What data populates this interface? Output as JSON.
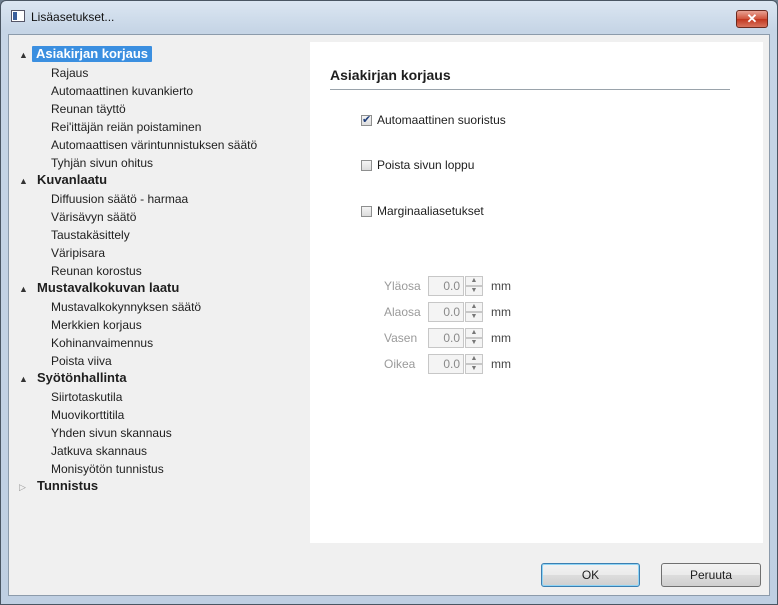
{
  "window": {
    "title": "Lisäasetukset...",
    "close_label": "✕"
  },
  "tree": {
    "categories": [
      {
        "label": "Asiakirjan korjaus",
        "selected": true,
        "children": [
          "Rajaus",
          "Automaattinen kuvankierto",
          "Reunan täyttö",
          "Rei'ittäjän reiän poistaminen",
          "Automaattisen värintunnistuksen säätö",
          "Tyhjän sivun ohitus"
        ]
      },
      {
        "label": "Kuvanlaatu",
        "children": [
          "Diffuusion säätö - harmaa",
          "Värisävyn säätö",
          "Taustakäsittely",
          "Väripisara",
          "Reunan korostus"
        ]
      },
      {
        "label": "Mustavalkokuvan laatu",
        "children": [
          "Mustavalkokynnyksen säätö",
          "Merkkien korjaus",
          "Kohinanvaimennus",
          "Poista viiva"
        ]
      },
      {
        "label": "Syötönhallinta",
        "children": [
          "Siirtotaskutila",
          "Muovikorttitila",
          "Yhden sivun skannaus",
          "Jatkuva skannaus",
          "Monisyötön tunnistus"
        ]
      },
      {
        "label": "Tunnistus",
        "collapsed": true,
        "children": []
      }
    ]
  },
  "panel": {
    "title": "Asiakirjan korjaus",
    "auto_straighten_label": "Automaattinen suoristus",
    "remove_page_end_label": "Poista sivun loppu",
    "margin_settings_label": "Marginaaliasetukset",
    "margins": [
      {
        "label": "Yläosa",
        "value": "0.0",
        "unit": "mm"
      },
      {
        "label": "Alaosa",
        "value": "0.0",
        "unit": "mm"
      },
      {
        "label": "Vasen",
        "value": "0.0",
        "unit": "mm"
      },
      {
        "label": "Oikea",
        "value": "0.0",
        "unit": "mm"
      }
    ]
  },
  "buttons": {
    "ok": "OK",
    "cancel": "Peruuta"
  },
  "icons": {
    "expanded": "▲",
    "collapsed": "▷",
    "spin_up": "▲",
    "spin_down": "▼"
  }
}
